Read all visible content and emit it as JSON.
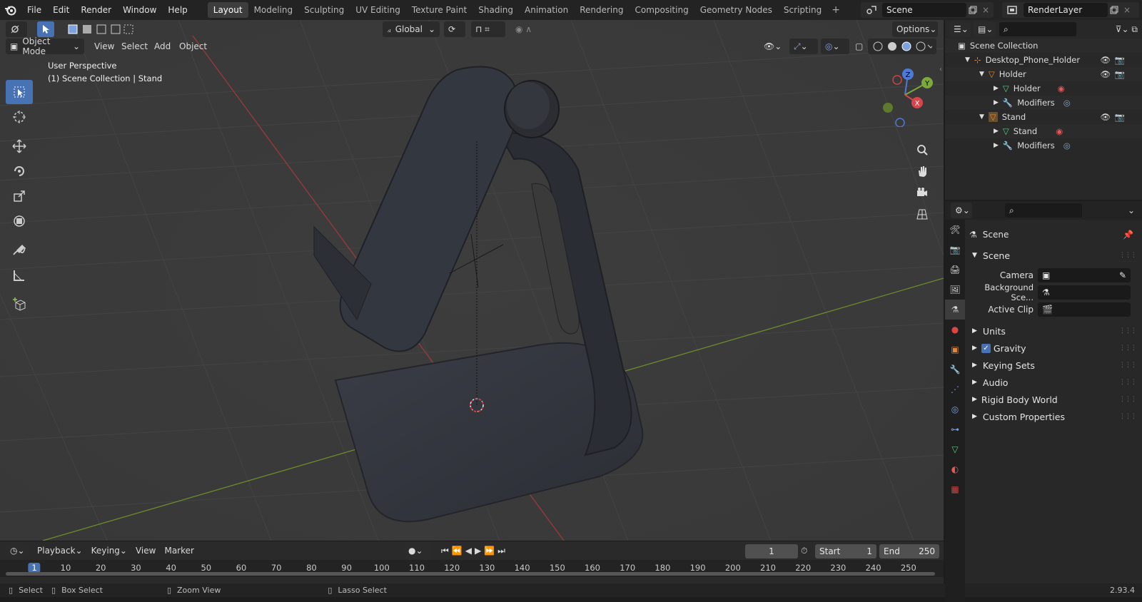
{
  "menus": [
    "File",
    "Edit",
    "Render",
    "Window",
    "Help"
  ],
  "workspaces": [
    "Layout",
    "Modeling",
    "Sculpting",
    "UV Editing",
    "Texture Paint",
    "Shading",
    "Animation",
    "Rendering",
    "Compositing",
    "Geometry Nodes",
    "Scripting"
  ],
  "active_workspace": "Layout",
  "scene_name": "Scene",
  "view_layer": "RenderLayer",
  "viewport": {
    "transform_orientation": "Global",
    "options_label": "Options",
    "mode": "Object Mode",
    "header_menus": [
      "View",
      "Select",
      "Add",
      "Object"
    ],
    "overlay_line1": "User Perspective",
    "overlay_line2": "(1) Scene Collection | Stand",
    "gizmo": {
      "x": "X",
      "y": "Y",
      "z": "Z"
    }
  },
  "outliner": {
    "root": "Scene Collection",
    "rows": [
      {
        "label": "Desktop_Phone_Holder",
        "indent": 1
      },
      {
        "label": "Holder",
        "indent": 2
      },
      {
        "label": "Holder",
        "indent": 3
      },
      {
        "label": "Modifiers",
        "indent": 3
      },
      {
        "label": "Stand",
        "indent": 2
      },
      {
        "label": "Stand",
        "indent": 3
      },
      {
        "label": "Modifiers",
        "indent": 3
      }
    ]
  },
  "properties": {
    "context_name": "Scene",
    "section_title": "Scene",
    "camera_label": "Camera",
    "bg_scene_label": "Background Sce...",
    "active_clip_label": "Active Clip",
    "sections": [
      "Units",
      "Gravity",
      "Keying Sets",
      "Audio",
      "Rigid Body World",
      "Custom Properties"
    ],
    "gravity_checked": true
  },
  "timeline": {
    "menus": [
      "Playback",
      "Keying",
      "View",
      "Marker"
    ],
    "current_frame": "1",
    "start_label": "Start",
    "start": "1",
    "end_label": "End",
    "end": "250",
    "ticks": [
      "1",
      "10",
      "20",
      "30",
      "40",
      "50",
      "60",
      "70",
      "80",
      "90",
      "100",
      "110",
      "120",
      "130",
      "140",
      "150",
      "160",
      "170",
      "180",
      "190",
      "200",
      "210",
      "220",
      "230",
      "240",
      "250"
    ]
  },
  "statusbar": {
    "select": "Select",
    "box_select": "Box Select",
    "zoom_view": "Zoom View",
    "lasso_select": "Lasso Select",
    "version": "2.93.4"
  }
}
